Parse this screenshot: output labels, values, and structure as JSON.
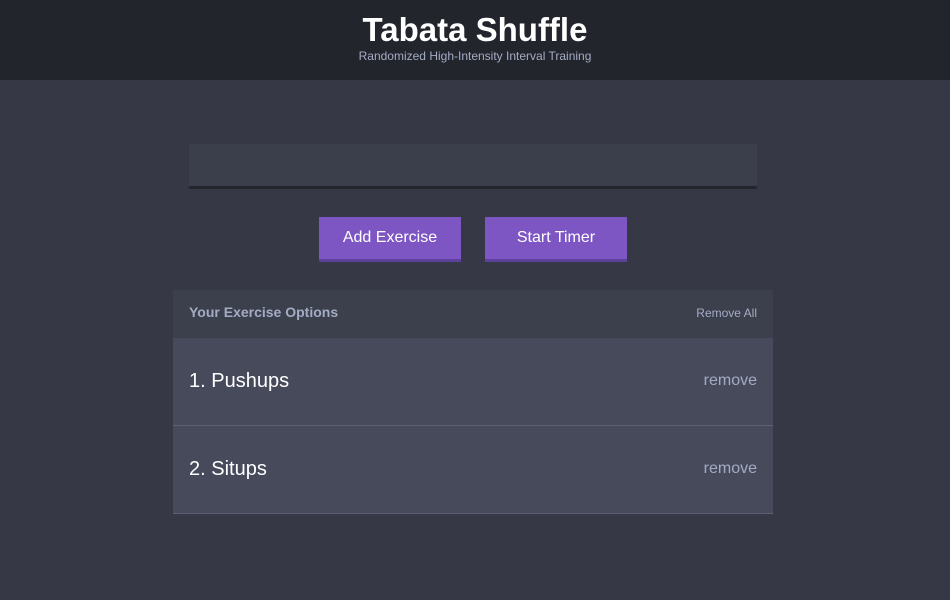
{
  "header": {
    "title": "Tabata Shuffle",
    "subtitle": "Randomized High-Intensity Interval Training"
  },
  "input": {
    "value": "",
    "placeholder": ""
  },
  "buttons": {
    "add_label": "Add Exercise",
    "start_label": "Start Timer"
  },
  "panel": {
    "title": "Your Exercise Options",
    "remove_all_label": "Remove All",
    "items": [
      {
        "label": "1. Pushups",
        "remove_label": "remove"
      },
      {
        "label": "2. Situps",
        "remove_label": "remove"
      }
    ]
  },
  "colors": {
    "background": "#363945",
    "header_background": "#23252d",
    "accent": "#7d56c3",
    "muted_text": "#a4abc4",
    "row_background": "#474a5b"
  }
}
